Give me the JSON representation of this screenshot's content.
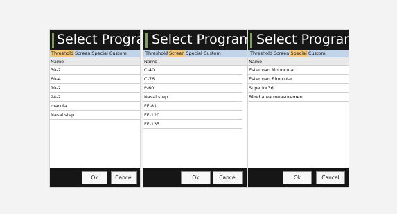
{
  "panels": [
    {
      "title": "Select Program",
      "tabs": [
        "Threshold",
        "Screen",
        "Special",
        "Custom"
      ],
      "active_tab": "Threshold",
      "column_header": "Name",
      "items": [
        "30-2",
        "60-4",
        "10-2",
        "24-2",
        "macula",
        "Nasal step"
      ],
      "ok_label": "Ok",
      "cancel_label": "Cancel"
    },
    {
      "title": "Select Program",
      "tabs": [
        "Threshold",
        "Screen",
        "Special",
        "Custom"
      ],
      "active_tab": "Screen",
      "column_header": "Name",
      "items": [
        "C-40",
        "C-76",
        "P-60",
        "Nasal step",
        "FF-81",
        "FF-120",
        "FF-135"
      ],
      "ok_label": "Ok",
      "cancel_label": "Cancel"
    },
    {
      "title": "Select Program",
      "tabs": [
        "Threshold",
        "Screen",
        "Special",
        "Custom"
      ],
      "active_tab": "Special",
      "column_header": "Name",
      "items": [
        "Esterman Monocular",
        "Esterman Binocular",
        "Superior36",
        "Blind area measurement"
      ],
      "ok_label": "Ok",
      "cancel_label": "Cancel"
    }
  ],
  "colors": {
    "header_bg": "#161616",
    "accent": "#7f9f5f",
    "tabbar_bg": "#c2d4ea",
    "active_tab_bg": "#f2c77a"
  }
}
